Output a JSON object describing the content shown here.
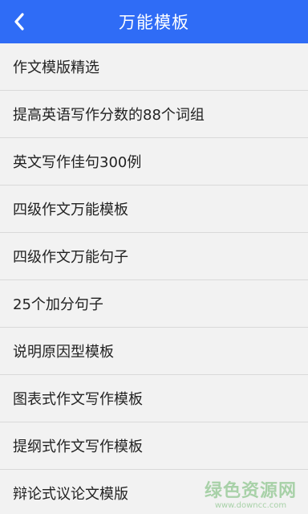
{
  "header": {
    "title": "万能模板",
    "back_icon": "chevron-left-icon",
    "color": "#2f6cf6"
  },
  "list": {
    "items": [
      {
        "label": "作文模版精选"
      },
      {
        "label": "提高英语写作分数的88个词组"
      },
      {
        "label": "英文写作佳句300例"
      },
      {
        "label": "四级作文万能模板"
      },
      {
        "label": "四级作文万能句子"
      },
      {
        "label": "25个加分句子"
      },
      {
        "label": "说明原因型模板"
      },
      {
        "label": "图表式作文写作模板"
      },
      {
        "label": "提纲式作文写作模板"
      },
      {
        "label": "辩论式议论文模版"
      }
    ]
  },
  "watermark": {
    "main": "绿色资源网",
    "sub": "www.downcc.com",
    "color": "#9ccc9c"
  }
}
